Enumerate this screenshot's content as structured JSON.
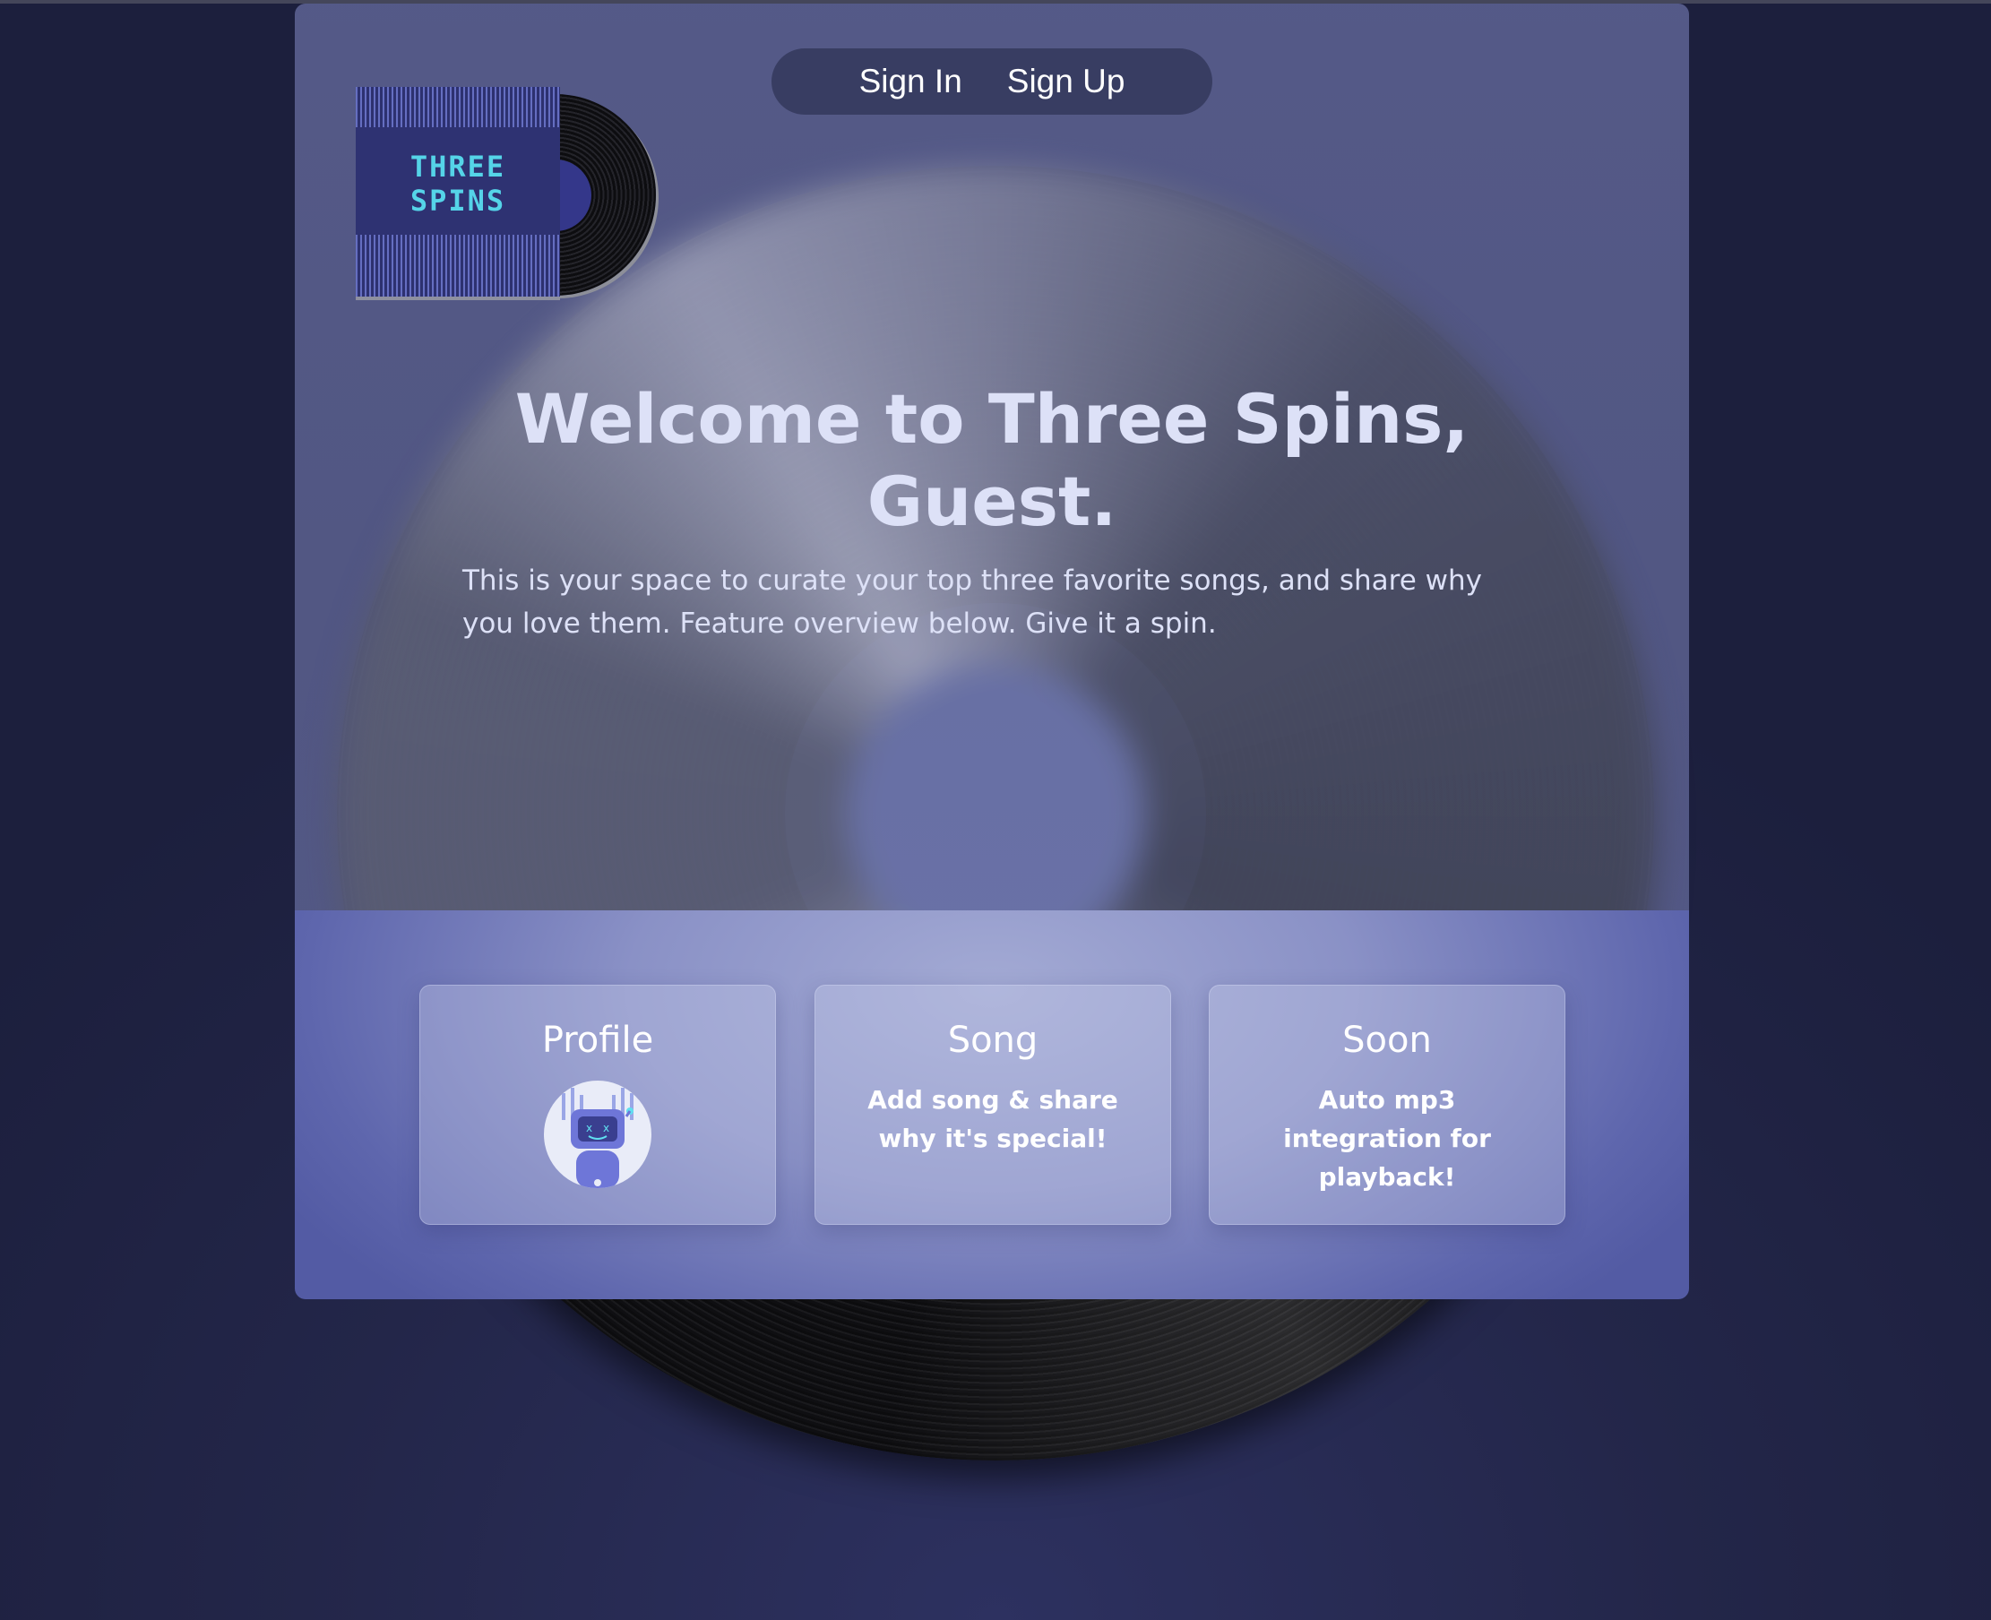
{
  "header": {
    "sign_in": "Sign In",
    "sign_up": "Sign Up"
  },
  "logo": {
    "line1": "THREE",
    "line2": "SPINS"
  },
  "hero": {
    "title_line1": "Welcome to Three Spins,",
    "title_line2": "Guest.",
    "subtitle": "This is your space to curate your top three favorite songs, and share why you love them. Feature overview below. Give it a spin."
  },
  "features": [
    {
      "title": "Profile",
      "icon": "robot-avatar-icon"
    },
    {
      "title": "Song",
      "text": "Add song & share why it's special!"
    },
    {
      "title": "Soon",
      "text": "Auto mp3 integration for playback!"
    }
  ],
  "colors": {
    "background": "#232649",
    "title_text": "#dde1f7",
    "logo_text": "#55d4e8",
    "feature_panel": "#8a91c6"
  }
}
